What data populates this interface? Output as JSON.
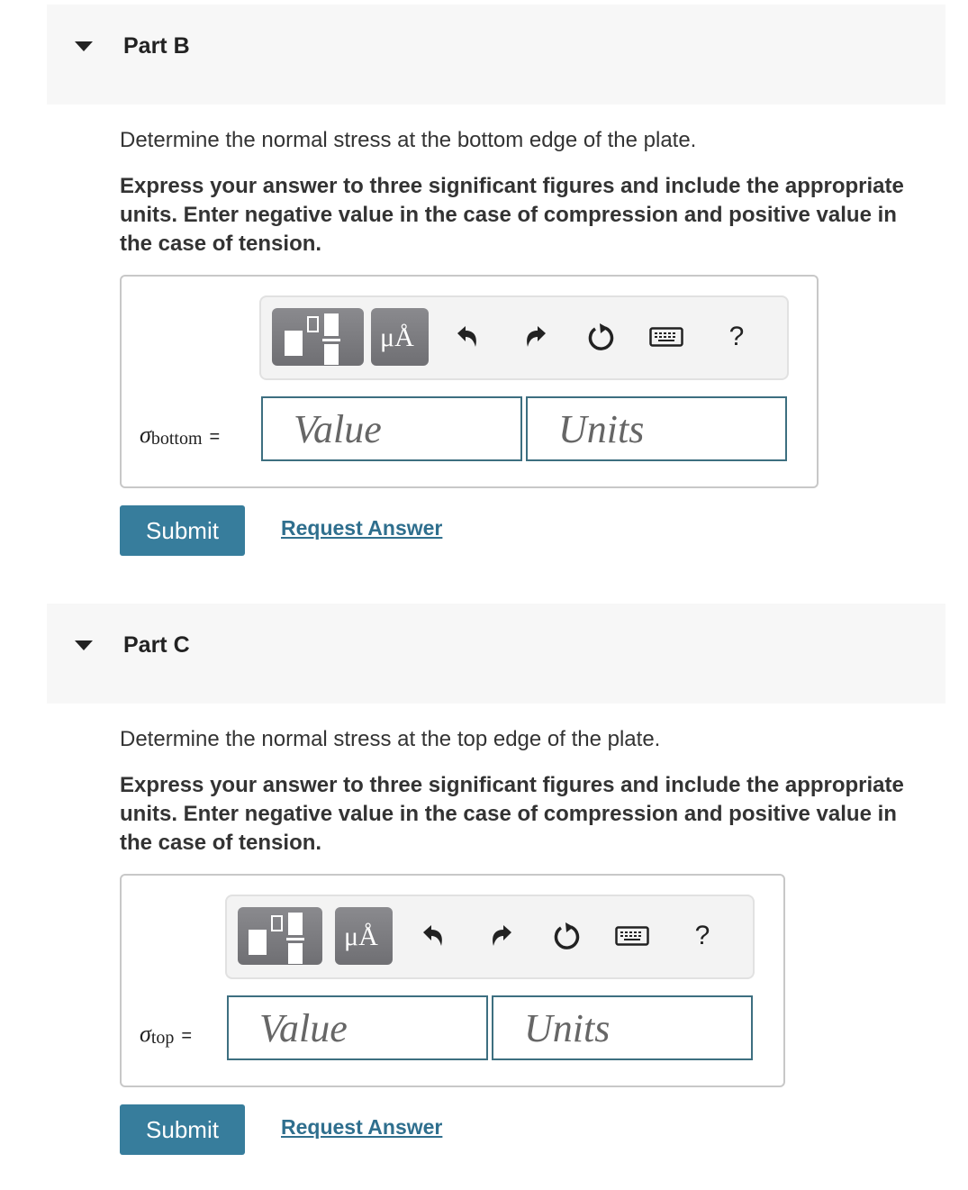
{
  "parts": [
    {
      "id": "B",
      "title": "Part B",
      "prompt": "Determine the normal stress at the bottom edge of the plate.",
      "instructions": "Express your answer to three significant figures and include the appropriate units. Enter negative value in the case of compression and positive value in the case of tension.",
      "variable": {
        "symbol": "σ",
        "subscript": "bottom",
        "equals": "="
      },
      "value_placeholder": "Value",
      "units_placeholder": "Units",
      "submit_label": "Submit",
      "request_label": "Request Answer"
    },
    {
      "id": "C",
      "title": "Part C",
      "prompt": "Determine the normal stress at the top edge of the plate.",
      "instructions": "Express your answer to three significant figures and include the appropriate units. Enter negative value in the case of compression and positive value in the case of tension.",
      "variable": {
        "symbol": "σ",
        "subscript": "top",
        "equals": "="
      },
      "value_placeholder": "Value",
      "units_placeholder": "Units",
      "submit_label": "Submit",
      "request_label": "Request Answer"
    }
  ],
  "toolbar": {
    "units_label": "μÅ",
    "help_label": "?",
    "icons": [
      "templates-icon",
      "units-icon",
      "undo-icon",
      "redo-icon",
      "reset-icon",
      "keyboard-icon",
      "help-icon"
    ]
  },
  "colors": {
    "accent": "#377d9c",
    "link": "#2f6f8e",
    "field_border": "#3d6f80"
  }
}
